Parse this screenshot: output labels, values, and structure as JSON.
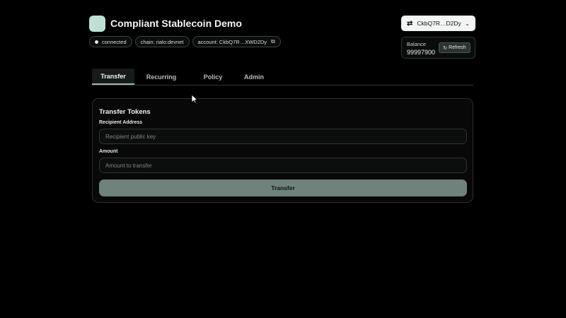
{
  "app": {
    "title": "Compliant Stablecoin Demo"
  },
  "status": {
    "connected": "connected",
    "chain": "chain: rialo:devnet",
    "account": "account: CkbQ7R…XWD2Dy"
  },
  "wallet": {
    "label": "CkbQ7R…D2Dy"
  },
  "balance": {
    "label": "Balance",
    "value": "99997900",
    "refresh_label": "Refresh"
  },
  "tabs": [
    {
      "label": "Transfer",
      "active": true
    },
    {
      "label": "Recurring",
      "active": false
    },
    {
      "label": "Policy",
      "active": false
    },
    {
      "label": "Admin",
      "active": false
    }
  ],
  "transfer": {
    "title": "Transfer Tokens",
    "recipient_label": "Recipient Address",
    "recipient_placeholder": "Recipient public key",
    "recipient_value": "",
    "amount_label": "Amount",
    "amount_placeholder": "Amount to transfer",
    "amount_value": "",
    "submit_label": "Transfer"
  },
  "colors": {
    "accent": "#bfe0d6",
    "button": "#6f827c",
    "background": "#000000"
  }
}
